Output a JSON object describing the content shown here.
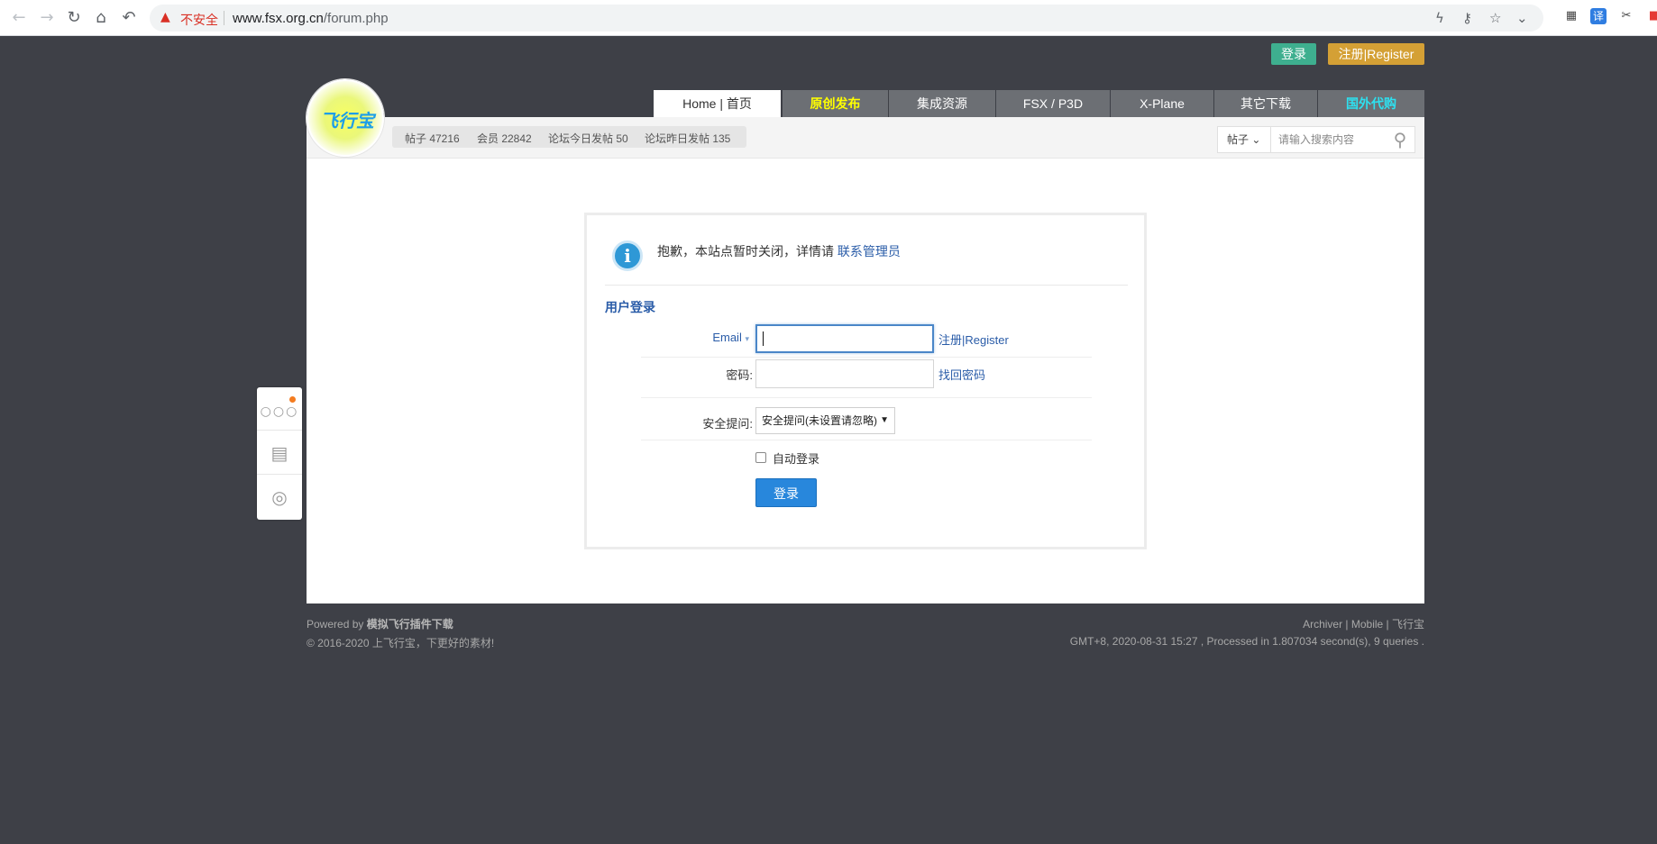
{
  "browser": {
    "security_label": "不安全",
    "url_host": "www.fsx.org.cn",
    "url_path": "/forum.php",
    "icons": [
      "back-icon",
      "forward-icon",
      "reload-icon",
      "home-icon",
      "undo-icon",
      "warning-icon",
      "flash-icon",
      "key-icon",
      "star-icon",
      "chevron-down-icon",
      "qr-icon",
      "translate-icon",
      "scissors-icon",
      "pdf-icon"
    ],
    "translate_label": "译"
  },
  "top_links": {
    "login": "登录",
    "register": "注册|Register"
  },
  "nav": {
    "tabs": [
      {
        "label": "Home | 首页"
      },
      {
        "label": "原创发布"
      },
      {
        "label": "集成资源"
      },
      {
        "label": "FSX / P3D"
      },
      {
        "label": "X-Plane"
      },
      {
        "label": "其它下载"
      },
      {
        "label": "国外代购"
      }
    ]
  },
  "logo": {
    "text": "飞行宝"
  },
  "stats": {
    "posts": "帖子 47216",
    "members": "会员 22842",
    "today": "论坛今日发帖 50",
    "yesterday": "论坛昨日发帖 135"
  },
  "search": {
    "type": "帖子",
    "placeholder": "请输入搜索内容"
  },
  "notice": {
    "text": "抱歉，本站点暂时关闭，详情请",
    "link": "联系管理员"
  },
  "login": {
    "title": "用户登录",
    "email_label": "Email",
    "register_link": "注册|Register",
    "password_label": "密码:",
    "forgot_link": "找回密码",
    "question_label": "安全提问:",
    "question_value": "安全提问(未设置请忽略)",
    "auto_login": "自动登录",
    "submit": "登录"
  },
  "footer": {
    "powered_prefix": "Powered by",
    "powered_name": "模拟飞行插件下载",
    "copyright": "© 2016-2020 上飞行宝，下更好的素材!",
    "links": "Archiver | Mobile | 飞行宝",
    "stats": "GMT+8, 2020-08-31 15:27 , Processed in 1.807034 second(s), 9 queries ."
  }
}
